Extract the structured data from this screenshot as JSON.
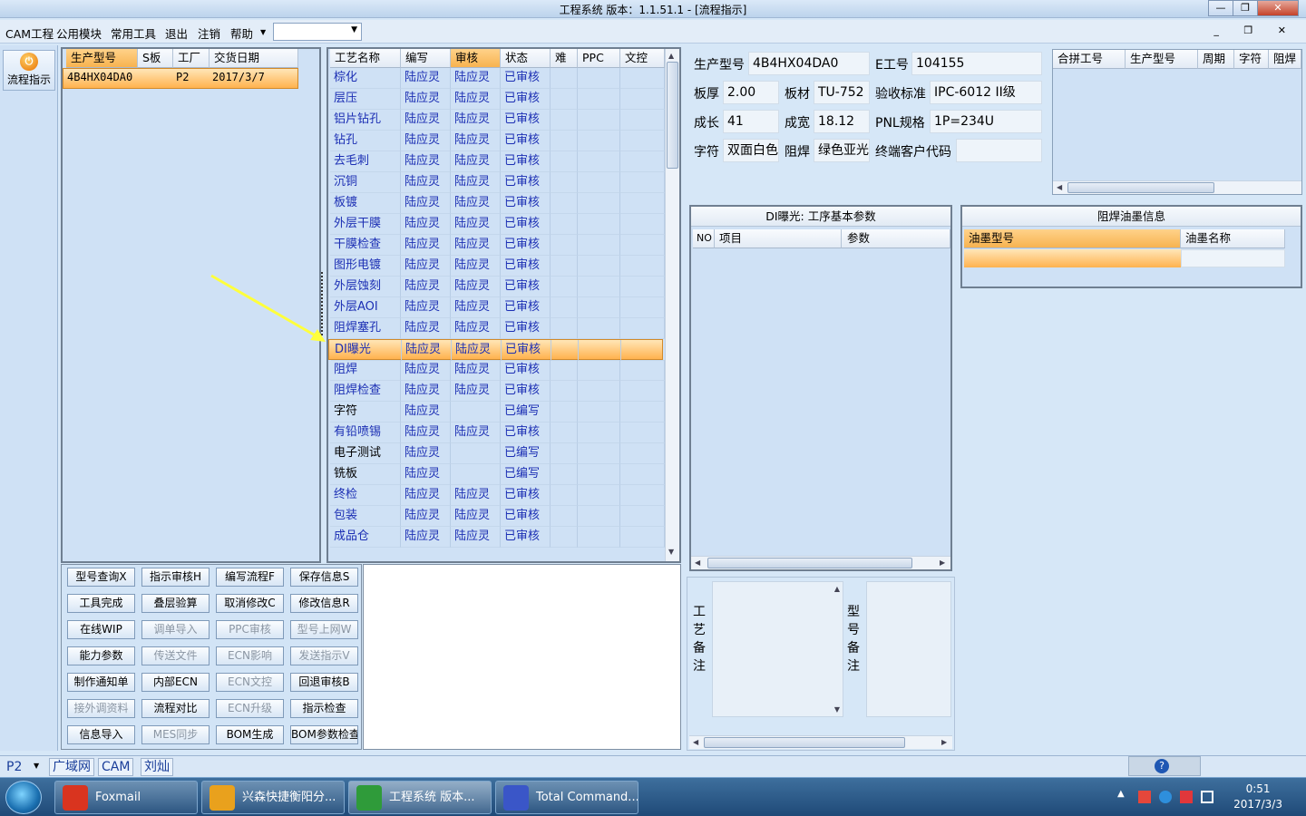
{
  "window": {
    "title": "工程系统   版本：1.1.51.1 - [流程指示]"
  },
  "menu": {
    "items": [
      "CAM工程",
      "公用模块",
      "常用工具",
      "退出",
      "注销",
      "帮助"
    ],
    "combo_value": ""
  },
  "left_nav": {
    "flow_button": "流程指示"
  },
  "order_grid": {
    "headers": [
      "生产型号",
      "S板",
      "工厂",
      "交货日期"
    ],
    "rows": [
      [
        "4B4HX04DA0",
        "",
        "P2",
        "2017/3/7"
      ]
    ]
  },
  "process_grid": {
    "headers": [
      "工艺名称",
      "编写",
      "审核",
      "状态",
      "难",
      "PPC",
      "文控"
    ],
    "selected_index": 13,
    "rows": [
      [
        "棕化",
        "陆应灵",
        "陆应灵",
        "已审核"
      ],
      [
        "层压",
        "陆应灵",
        "陆应灵",
        "已审核"
      ],
      [
        "铝片钻孔",
        "陆应灵",
        "陆应灵",
        "已审核"
      ],
      [
        "钻孔",
        "陆应灵",
        "陆应灵",
        "已审核"
      ],
      [
        "去毛刺",
        "陆应灵",
        "陆应灵",
        "已审核"
      ],
      [
        "沉铜",
        "陆应灵",
        "陆应灵",
        "已审核"
      ],
      [
        "板镀",
        "陆应灵",
        "陆应灵",
        "已审核"
      ],
      [
        "外层干膜",
        "陆应灵",
        "陆应灵",
        "已审核"
      ],
      [
        "干膜检查",
        "陆应灵",
        "陆应灵",
        "已审核"
      ],
      [
        "图形电镀",
        "陆应灵",
        "陆应灵",
        "已审核"
      ],
      [
        "外层蚀刻",
        "陆应灵",
        "陆应灵",
        "已审核"
      ],
      [
        "外层AOI",
        "陆应灵",
        "陆应灵",
        "已审核"
      ],
      [
        "阻焊塞孔",
        "陆应灵",
        "陆应灵",
        "已审核"
      ],
      [
        "DI曝光",
        "陆应灵",
        "陆应灵",
        "已审核"
      ],
      [
        "阻焊",
        "陆应灵",
        "陆应灵",
        "已审核"
      ],
      [
        "阻焊检查",
        "陆应灵",
        "陆应灵",
        "已审核"
      ],
      [
        "字符",
        "陆应灵",
        "",
        "已编写"
      ],
      [
        "有铅喷锡",
        "陆应灵",
        "陆应灵",
        "已审核"
      ],
      [
        "电子测试",
        "陆应灵",
        "",
        "已编写"
      ],
      [
        "铣板",
        "陆应灵",
        "",
        "已编写"
      ],
      [
        "终检",
        "陆应灵",
        "陆应灵",
        "已审核"
      ],
      [
        "包装",
        "陆应灵",
        "陆应灵",
        "已审核"
      ],
      [
        "成品仓",
        "陆应灵",
        "陆应灵",
        "已审核"
      ]
    ]
  },
  "actions": {
    "rows": [
      [
        {
          "label": "型号查询X",
          "enabled": true
        },
        {
          "label": "指示审核H",
          "enabled": true
        },
        {
          "label": "编写流程F",
          "enabled": true
        },
        {
          "label": "保存信息S",
          "enabled": true
        }
      ],
      [
        {
          "label": "工具完成",
          "enabled": true
        },
        {
          "label": "叠层验算",
          "enabled": true
        },
        {
          "label": "取消修改C",
          "enabled": true
        },
        {
          "label": "修改信息R",
          "enabled": true
        }
      ],
      [
        {
          "label": "在线WIP",
          "enabled": true
        },
        {
          "label": "调单导入",
          "enabled": false
        },
        {
          "label": "PPC审核",
          "enabled": false
        },
        {
          "label": "型号上网W",
          "enabled": false
        }
      ],
      [
        {
          "label": "能力参数",
          "enabled": true
        },
        {
          "label": "传送文件",
          "enabled": false
        },
        {
          "label": "ECN影响",
          "enabled": false
        },
        {
          "label": "发送指示V",
          "enabled": false
        }
      ],
      [
        {
          "label": "制作通知单",
          "enabled": true
        },
        {
          "label": "内部ECN",
          "enabled": true
        },
        {
          "label": "ECN文控",
          "enabled": false
        },
        {
          "label": "回退审核B",
          "enabled": true
        }
      ],
      [
        {
          "label": "接外调资料",
          "enabled": false
        },
        {
          "label": "流程对比",
          "enabled": true
        },
        {
          "label": "ECN升级",
          "enabled": false
        },
        {
          "label": "指示检查",
          "enabled": true
        }
      ],
      [
        {
          "label": "信息导入",
          "enabled": true
        },
        {
          "label": "MES同步",
          "enabled": false
        },
        {
          "label": "BOM生成",
          "enabled": true
        },
        {
          "label": "BOM参数检查",
          "enabled": true
        }
      ]
    ]
  },
  "info": {
    "model_label": "生产型号",
    "model_value": "4B4HX04DA0",
    "e_label": "E工号",
    "e_value": "104155",
    "thick_label": "板厚",
    "thick_value": "2.00",
    "material_label": "板材",
    "material_value": "TU-752",
    "standard_label": "验收标准",
    "standard_value": "IPC-6012 II级",
    "length_label": "成长",
    "length_value": "41",
    "width_label": "成宽",
    "width_value": "18.12",
    "pnl_label": "PNL规格",
    "pnl_value": "1P=234U",
    "char_label": "字符",
    "char_value": "双面白色",
    "mask_label": "阻焊",
    "mask_value": "绿色亚光",
    "customer_label": "终端客户代码",
    "customer_value": ""
  },
  "combined_grid": {
    "headers": [
      "合拼工号",
      "生产型号",
      "周期",
      "字符",
      "阻焊"
    ]
  },
  "di_panel": {
    "title": "DI曝光: 工序基本参数",
    "headers": [
      "NO",
      "项目",
      "参数"
    ]
  },
  "ink_panel": {
    "title": "阻焊油墨信息",
    "headers": [
      "油墨型号",
      "油墨名称"
    ]
  },
  "notes": {
    "process_label": "工艺备注",
    "model_label": "型号备注"
  },
  "status": {
    "factory": "P2",
    "tabs": [
      "广域网",
      "CAM",
      "刘灿"
    ]
  },
  "taskbar": {
    "tasks": [
      {
        "label": "Foxmail",
        "color": "#d9341f"
      },
      {
        "label": "兴森快捷衡阳分...",
        "color": "#e9a11d"
      },
      {
        "label": "工程系统   版本...",
        "color": "#2f9b3a"
      },
      {
        "label": "Total Command...",
        "color": "#3a56c8"
      }
    ],
    "time": "0:51",
    "date": "2017/3/3"
  }
}
